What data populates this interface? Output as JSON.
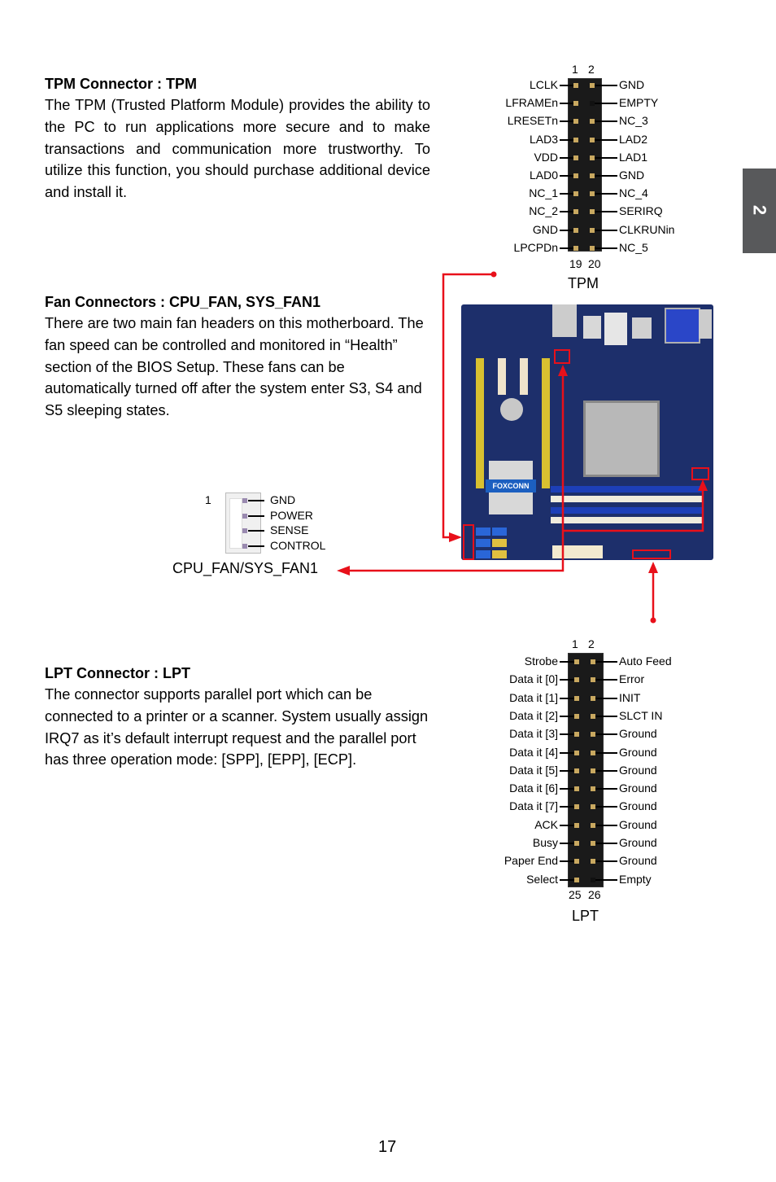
{
  "side_tab": {
    "label": "2"
  },
  "sections": {
    "tpm": {
      "title": "TPM Connector : TPM",
      "body": "The TPM (Trusted Platform Module) provides the ability to the PC to run applications more secure and to make transactions and communication more trustworthy. To utilize this function, you should purchase additional device and install it."
    },
    "fan": {
      "title": "Fan Connectors : CPU_FAN, SYS_FAN1",
      "body": "There are two main fan headers on this motherboard. The fan speed can be controlled and monitored in “Health” section of the BIOS Setup. These fans can be automatically turned off after the system enter S3, S4 and S5 sleeping states."
    },
    "lpt": {
      "title": "LPT Connector : LPT",
      "body": "The connector supports parallel port which can be connected to a printer or a scanner. System usually assign IRQ7 as it’s default interrupt request and the parallel port has three operation mode: [SPP], [EPP], [ECP]."
    }
  },
  "tpm_diagram": {
    "caption": "TPM",
    "top_pins": [
      "1",
      "2"
    ],
    "bottom_pins": [
      "19",
      "20"
    ],
    "left": [
      "LCLK",
      "LFRAMEn",
      "LRESETn",
      "LAD3",
      "VDD",
      "LAD0",
      "NC_1",
      "NC_2",
      "GND",
      "LPCPDn"
    ],
    "right": [
      "GND",
      "EMPTY",
      "NC_3",
      "LAD2",
      "LAD1",
      "GND",
      "NC_4",
      "SERIRQ",
      "CLKRUNin",
      "NC_5"
    ]
  },
  "fan_diagram": {
    "caption": "CPU_FAN/SYS_FAN1",
    "pin1": "1",
    "pins": [
      "GND",
      "POWER",
      "SENSE",
      "CONTROL"
    ]
  },
  "lpt_diagram": {
    "caption": "LPT",
    "top_pins": [
      "1",
      "2"
    ],
    "bottom_pins": [
      "25",
      "26"
    ],
    "left": [
      "Strobe",
      "Data it [0]",
      "Data it [1]",
      "Data it [2]",
      "Data it [3]",
      "Data it [4]",
      "Data it [5]",
      "Data it [6]",
      "Data it [7]",
      "ACK",
      "Busy",
      "Paper End",
      "Select"
    ],
    "right": [
      "Auto Feed",
      "Error",
      "INIT",
      "SLCT IN",
      "Ground",
      "Ground",
      "Ground",
      "Ground",
      "Ground",
      "Ground",
      "Ground",
      "Ground",
      "Empty"
    ]
  },
  "motherboard": {
    "brand": "FOXCONN"
  },
  "page_number": "17",
  "colors": {
    "accent": "#e8101a",
    "tab": "#58595b"
  }
}
